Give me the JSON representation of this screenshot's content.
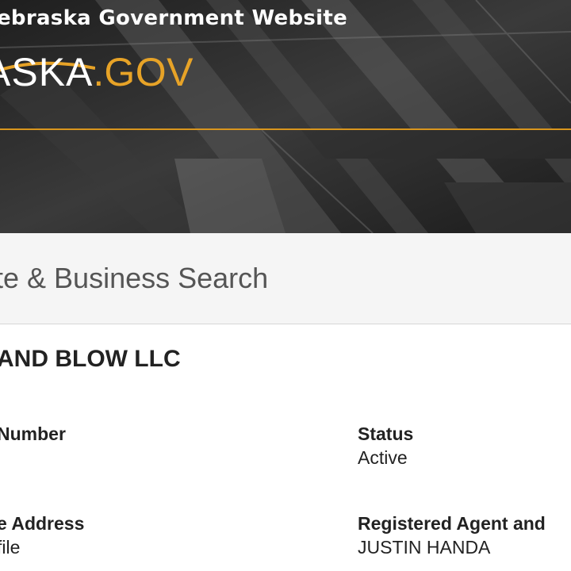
{
  "header": {
    "official_text": "ebraska Government Website",
    "logo_word": "ASKA",
    "logo_dot": ".",
    "logo_tld": "GOV",
    "accent_color": "#e7a327"
  },
  "search": {
    "title": "te & Business Search"
  },
  "entity": {
    "name": "AND BLOW LLC",
    "fields": {
      "number": {
        "label": "Number",
        "value": ""
      },
      "status": {
        "label": "Status",
        "value": "Active"
      },
      "address": {
        "label": "e Address",
        "value": "file"
      },
      "agent": {
        "label": "Registered Agent and",
        "value": "JUSTIN HANDA"
      }
    }
  }
}
